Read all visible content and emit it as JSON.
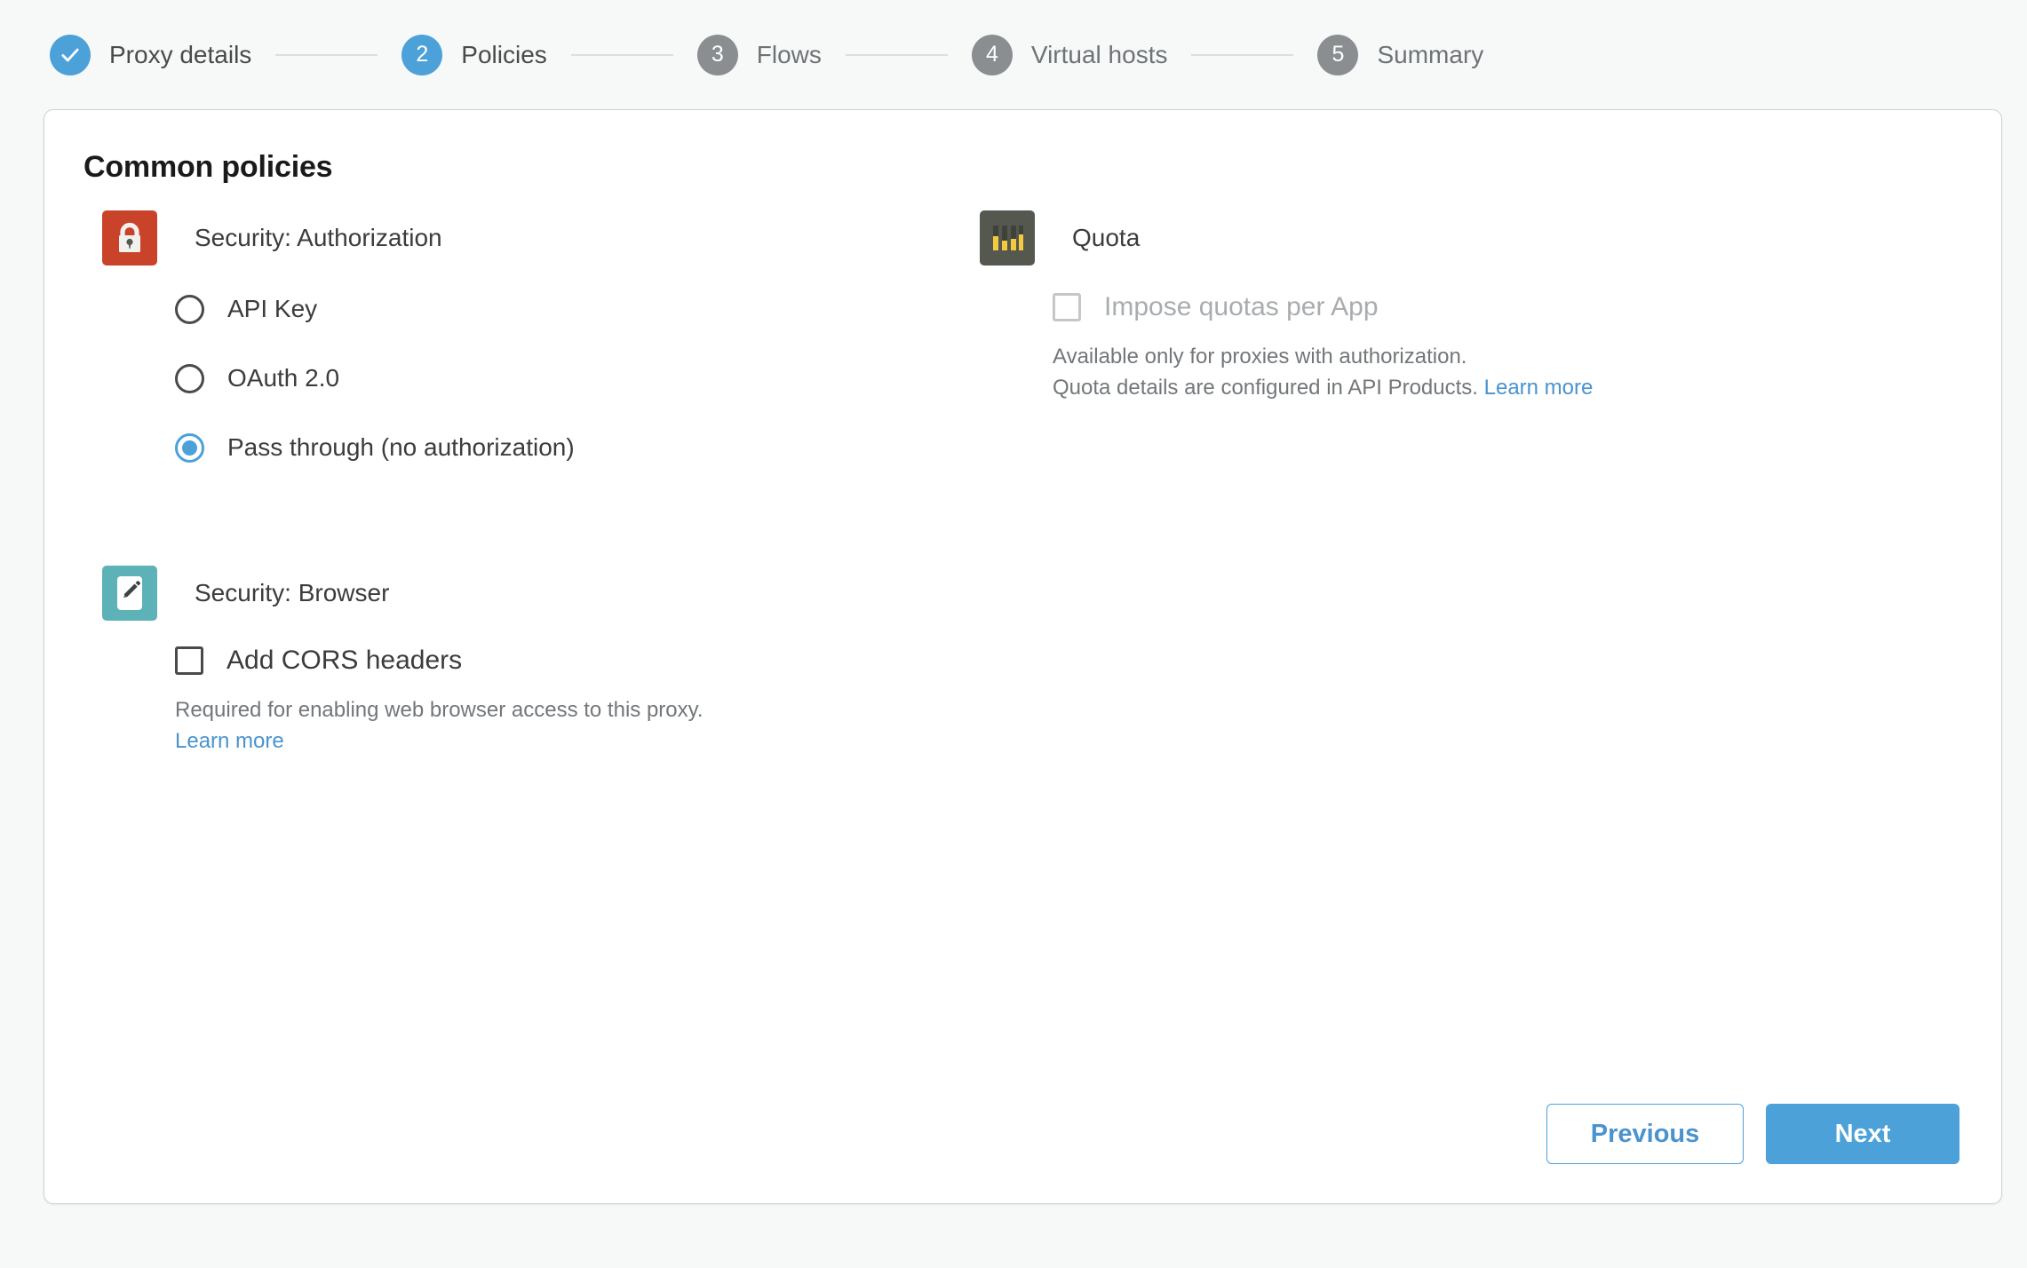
{
  "stepper": {
    "steps": [
      {
        "num": "✓",
        "label": "Proxy details",
        "state": "done"
      },
      {
        "num": "2",
        "label": "Policies",
        "state": "current"
      },
      {
        "num": "3",
        "label": "Flows",
        "state": "todo"
      },
      {
        "num": "4",
        "label": "Virtual hosts",
        "state": "todo"
      },
      {
        "num": "5",
        "label": "Summary",
        "state": "todo"
      }
    ]
  },
  "card": {
    "title": "Common policies"
  },
  "policies": {
    "authorization": {
      "icon": "lock-icon",
      "name": "Security: Authorization",
      "options": [
        {
          "label": "API Key",
          "checked": false
        },
        {
          "label": "OAuth 2.0",
          "checked": false
        },
        {
          "label": "Pass through (no authorization)",
          "checked": true
        }
      ]
    },
    "browser": {
      "icon": "pencil-icon",
      "name": "Security: Browser",
      "checkbox_label": "Add CORS headers",
      "checked": false,
      "helper": "Required for enabling web browser access to this proxy.",
      "learn_more": "Learn more"
    },
    "quota": {
      "icon": "quota-bars-icon",
      "name": "Quota",
      "checkbox_label": "Impose quotas per App",
      "checked": false,
      "disabled": true,
      "helper_line1": "Available only for proxies with authorization.",
      "helper_line2": "Quota details are configured in API Products.",
      "learn_more": "Learn more"
    }
  },
  "footer": {
    "previous_label": "Previous",
    "next_label": "Next"
  },
  "colors": {
    "accent_blue": "#4ca1d8",
    "link_blue": "#4a93cf",
    "lock_red": "#c9432a",
    "browser_teal": "#5cb2b6",
    "quota_dark": "#54584f",
    "quota_bar_yellow": "#f2c93f",
    "step_todo_gray": "#8b8e91",
    "page_bg": "#f7f8f8"
  }
}
